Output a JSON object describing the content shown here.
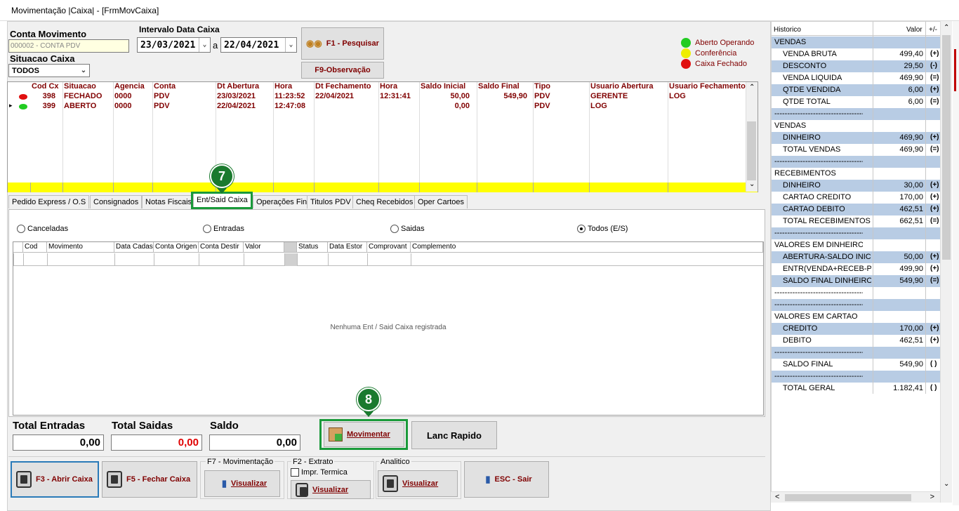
{
  "window": {
    "title": "Movimentação |Caixa| - [FrmMovCaixa]"
  },
  "header": {
    "conta_movimento_label": "Conta Movimento",
    "conta_movimento_value": "000002 - CONTA PDV",
    "situacao_label": "Situacao Caixa",
    "situacao_value": "TODOS",
    "intervalo_label": "Intervalo Data Caixa",
    "date_from": "23/03/2021",
    "date_sep": "a",
    "date_to": "22/04/2021",
    "search_btn": "F1 - Pesquisar",
    "obs_btn": "F9-Observação"
  },
  "legend": {
    "items": [
      {
        "label": "Aberto Operando",
        "color": "#22cc22"
      },
      {
        "label": "Conferência",
        "color": "#eeee00"
      },
      {
        "label": "Caixa Fechado",
        "color": "#e01010"
      }
    ]
  },
  "caixa_grid": {
    "headers": [
      "Cod Cx",
      "Situacao",
      "Agencia",
      "Conta",
      "Dt Abertura",
      "Hora",
      "Dt Fechamento",
      "Hora",
      "Saldo Inicial",
      "Saldo Final",
      "Tipo",
      "Usuario Abertura",
      "Usuario Fechamento"
    ],
    "rows": [
      {
        "status_color": "#e01010",
        "cells": [
          "398",
          "FECHADO",
          "0000",
          "PDV",
          "23/03/2021",
          "11:23:52",
          "22/04/2021",
          "12:31:41",
          "50,00",
          "549,90",
          "PDV",
          "GERENTE",
          "LOG"
        ]
      },
      {
        "status_color": "#22cc22",
        "cells": [
          "399",
          "ABERTO",
          "0000",
          "PDV",
          "22/04/2021",
          "12:47:08",
          "",
          "",
          "0,00",
          "",
          "PDV",
          "LOG",
          ""
        ]
      }
    ]
  },
  "tabs": [
    {
      "label": "Pedido Express / O.S"
    },
    {
      "label": "Consignados"
    },
    {
      "label": "Notas Fiscais"
    },
    {
      "label": "Ent/Said Caixa",
      "active": true
    },
    {
      "label": "Operações Fin"
    },
    {
      "label": "Titulos PDV"
    },
    {
      "label": "Cheq Recebidos"
    },
    {
      "label": "Oper Cartoes"
    }
  ],
  "filters": [
    {
      "label": "Canceladas",
      "checked": false
    },
    {
      "label": "Entradas",
      "checked": false
    },
    {
      "label": "Saidas",
      "checked": false
    },
    {
      "label": "Todos (E/S)",
      "checked": true
    }
  ],
  "inner_grid": {
    "headers": [
      "Cod",
      "Movimento",
      "Data Cadas",
      "Conta Origen",
      "Conta Destir",
      "Valor",
      "",
      "Status",
      "Data Estor",
      "Comprovant",
      "Complemento"
    ],
    "empty_text": "Nenhuma Ent / Said Caixa registrada"
  },
  "totals": {
    "entradas_label": "Total Entradas",
    "entradas_value": "0,00",
    "saidas_label": "Total Saidas",
    "saidas_value": "0,00",
    "saldo_label": "Saldo",
    "saldo_value": "0,00"
  },
  "actions": {
    "movimentar": "Movimentar",
    "lanc_rapido": "Lanc Rapido"
  },
  "badges": {
    "tab": "7",
    "movimentar": "8"
  },
  "bottom": {
    "abrir": "F3 - Abrir Caixa",
    "fechar": "F5 - Fechar Caixa",
    "mov_group": "F7 - Movimentação",
    "mov_btn": "Visualizar",
    "extrato_group": "F2 - Extrato",
    "impr_label": "Impr. Termica",
    "extrato_btn": "Visualizar",
    "analitico_group": "Analitico",
    "analitico_btn": "Visualizar",
    "sair": "ESC - Sair"
  },
  "summary": {
    "headers": {
      "historico": "Historico",
      "valor": "Valor",
      "sign": "+/-"
    },
    "rows": [
      {
        "name": "VENDAS",
        "value": "",
        "sign": "",
        "type": "h",
        "blue": true
      },
      {
        "name": "VENDA BRUTA",
        "value": "499,40",
        "sign": "(+)",
        "blue": false
      },
      {
        "name": "DESCONTO",
        "value": "29,50",
        "sign": "(-)",
        "blue": true
      },
      {
        "name": "VENDA LIQUIDA",
        "value": "469,90",
        "sign": "(=)",
        "blue": false
      },
      {
        "name": "QTDE VENDIDA",
        "value": "6,00",
        "sign": "(+)",
        "blue": true
      },
      {
        "name": "QTDE TOTAL",
        "value": "6,00",
        "sign": "(=)",
        "blue": false
      },
      {
        "name": "-----------------------------------------------",
        "value": "",
        "sign": "",
        "type": "h",
        "blue": true
      },
      {
        "name": "VENDAS",
        "value": "",
        "sign": "",
        "type": "h",
        "blue": false
      },
      {
        "name": "DINHEIRO",
        "value": "469,90",
        "sign": "(+)",
        "blue": true
      },
      {
        "name": "TOTAL VENDAS",
        "value": "469,90",
        "sign": "(=)",
        "blue": false
      },
      {
        "name": "-----------------------------------------------",
        "value": "",
        "sign": "",
        "type": "h",
        "blue": true
      },
      {
        "name": "RECEBIMENTOS",
        "value": "",
        "sign": "",
        "type": "h",
        "blue": false
      },
      {
        "name": "DINHEIRO",
        "value": "30,00",
        "sign": "(+)",
        "blue": true
      },
      {
        "name": "CARTAO CREDITO",
        "value": "170,00",
        "sign": "(+)",
        "blue": false
      },
      {
        "name": "CARTAO DEBITO",
        "value": "462,51",
        "sign": "(+)",
        "blue": true
      },
      {
        "name": "TOTAL RECEBIMENTOS",
        "value": "662,51",
        "sign": "(=)",
        "blue": false
      },
      {
        "name": "-----------------------------------------------",
        "value": "",
        "sign": "",
        "type": "h",
        "blue": true
      },
      {
        "name": "VALORES EM DINHEIRO",
        "value": "",
        "sign": "",
        "type": "h",
        "blue": false
      },
      {
        "name": "ABERTURA-SALDO INICIAL",
        "value": "50,00",
        "sign": "(+)",
        "blue": true
      },
      {
        "name": "ENTR(VENDA+RECEB-PGTO)",
        "value": "499,90",
        "sign": "(+)",
        "blue": false
      },
      {
        "name": "SALDO FINAL DINHEIRO",
        "value": "549,90",
        "sign": "(=)",
        "blue": true
      },
      {
        "name": "-----------------------------------------------",
        "value": "",
        "sign": "",
        "type": "h",
        "blue": false
      },
      {
        "name": "-----------------------------------------------",
        "value": "",
        "sign": "",
        "type": "h",
        "blue": true
      },
      {
        "name": "VALORES EM CARTAO",
        "value": "",
        "sign": "",
        "type": "h",
        "blue": false
      },
      {
        "name": "CREDITO",
        "value": "170,00",
        "sign": "(+)",
        "blue": true
      },
      {
        "name": "DEBITO",
        "value": "462,51",
        "sign": "(+)",
        "blue": false
      },
      {
        "name": "-----------------------------------------------",
        "value": "",
        "sign": "",
        "type": "h",
        "blue": true
      },
      {
        "name": "SALDO FINAL",
        "value": "549,90",
        "sign": "( )",
        "blue": false
      },
      {
        "name": "-----------------------------------------------",
        "value": "",
        "sign": "",
        "type": "h",
        "blue": true
      },
      {
        "name": "TOTAL GERAL",
        "value": "1.182,41",
        "sign": "( )",
        "blue": false
      }
    ]
  }
}
